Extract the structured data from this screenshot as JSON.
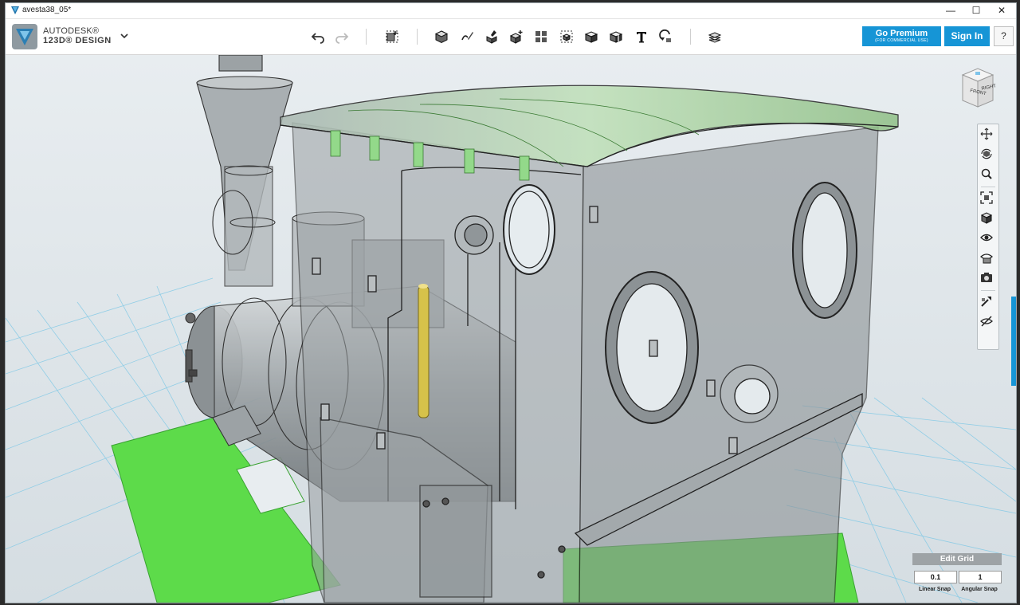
{
  "window": {
    "title": "avesta38_05*",
    "controls": {
      "minimize": "—",
      "maximize": "☐",
      "close": "✕"
    }
  },
  "brand": {
    "top": "AUTODESK®",
    "main": "123D® DESIGN"
  },
  "toolbar": {
    "items": [
      {
        "name": "undo-icon"
      },
      {
        "name": "redo-icon"
      },
      {
        "name": "transform-icon"
      },
      {
        "name": "primitives-icon"
      },
      {
        "name": "sketch-icon"
      },
      {
        "name": "construct-icon"
      },
      {
        "name": "modify-icon"
      },
      {
        "name": "pattern-icon"
      },
      {
        "name": "grouping-icon"
      },
      {
        "name": "combine-icon"
      },
      {
        "name": "measure-icon"
      },
      {
        "name": "text-icon"
      },
      {
        "name": "snap-icon"
      },
      {
        "name": "material-icon"
      }
    ]
  },
  "header": {
    "premium_label": "Go Premium",
    "premium_sub": "(FOR COMMERCIAL USE)",
    "signin_label": "Sign In",
    "help_label": "?"
  },
  "viewcube": {
    "front": "FRONT",
    "right": "RIGHT"
  },
  "navbar": {
    "items": [
      {
        "name": "pan-icon"
      },
      {
        "name": "orbit-icon"
      },
      {
        "name": "zoom-icon"
      },
      {
        "name": "fit-icon"
      },
      {
        "name": "views-icon"
      },
      {
        "name": "visibility-icon"
      },
      {
        "name": "materials-outlines-icon"
      },
      {
        "name": "screenshot-icon"
      },
      {
        "name": "snap-tool-icon"
      },
      {
        "name": "hide-icon"
      }
    ]
  },
  "edit_grid": {
    "title": "Edit Grid",
    "linear_snap_value": "0.1",
    "angular_snap_value": "1",
    "linear_snap_label": "Linear Snap",
    "angular_snap_label": "Angular Snap"
  },
  "colors": {
    "accent": "#1695d6",
    "grid_line": "#7ec8e6",
    "base_plate": "#5ddb4a",
    "cab_fill": "#9aa0a3",
    "roof_green": "#93d98a",
    "yellow_rod": "#d6c24a"
  }
}
